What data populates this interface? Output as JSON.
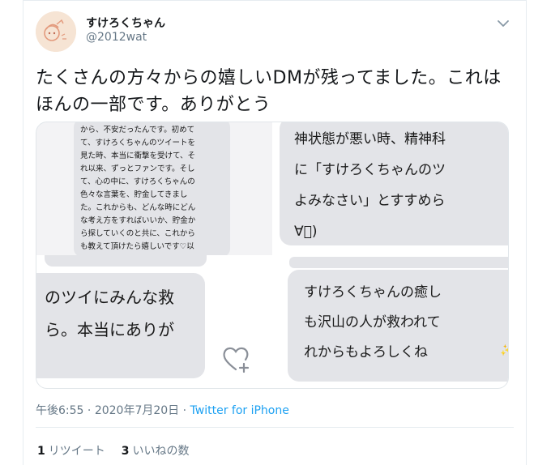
{
  "author": {
    "name": "すけろくちゃん",
    "handle": "@2012wat"
  },
  "tweet": {
    "line1": "たくさんの方々からの嬉しいDMが残ってました。これは",
    "line2": "ほんの一部です。ありがとう"
  },
  "media": {
    "top_left_lines": [
      "から、不安だったんです。初めて",
      "て、すけろくちゃんのツイートを",
      "見た時、本当に衝撃を受けて、そ",
      "れ以来、ずっとファンです。そし",
      "て、心の中に、すけろくちゃんの",
      "色々な言葉を、貯金してきまし",
      "た。これからも、どんな時にどん",
      "な考え方をすればいいか、貯金か",
      "ら探していくのと共に、これから",
      "も教えて頂けたら嬉しいです♡以"
    ],
    "top_right_lines": [
      "神状態が悪い時、精神科",
      "に「すけろくちゃんのツ",
      "よみなさい」とすすめら",
      "∀ﾟ)"
    ],
    "bottom_left_lines": [
      "のツイにみんな救",
      "ら。本当にありが"
    ],
    "bottom_right_lines": [
      "すけろくちゃんの癒し",
      "も沢山の人が救われて",
      "れからもよろしくね"
    ]
  },
  "meta": {
    "time": "午後6:55",
    "sep": " · ",
    "date": "2020年7月20日",
    "sep2": " · ",
    "source": "Twitter for iPhone"
  },
  "stats": {
    "retweets_count": "1",
    "retweets_label": "リツイート",
    "likes_count": "3",
    "likes_label": "いいねの数"
  },
  "colors": {
    "link": "#1da1f2",
    "muted": "#657786",
    "text": "#14171a"
  },
  "icons": {
    "chevron": "chevron-down-icon",
    "heart_plus": "heart-plus-icon"
  }
}
